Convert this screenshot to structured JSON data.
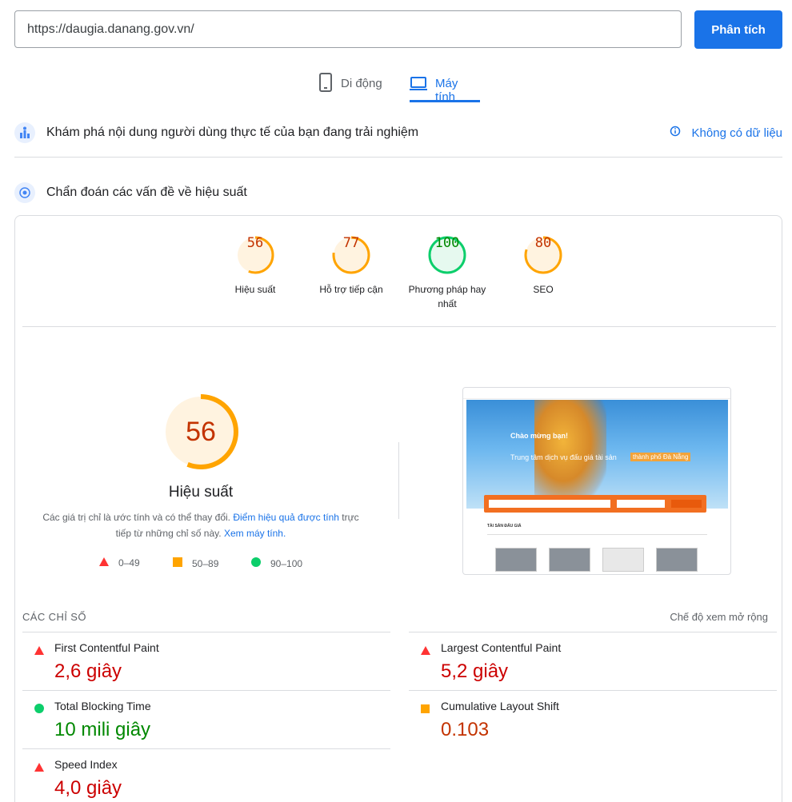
{
  "search": {
    "url": "https://daugia.danang.gov.vn/",
    "button": "Phân tích"
  },
  "tabs": {
    "mobile": "Di động",
    "desktop": "Máy tính"
  },
  "field_data": {
    "title": "Khám phá nội dung người dùng thực tế của bạn đang trải nghiệm",
    "no_data": "Không có dữ liệu"
  },
  "diagnose": {
    "title": "Chẩn đoán các vấn đề về hiệu suất"
  },
  "scores": [
    {
      "label": "Hiệu suất",
      "value": "56",
      "score": 56
    },
    {
      "label": "Hỗ trợ tiếp cận",
      "value": "77",
      "score": 77
    },
    {
      "label": "Phương pháp hay nhất",
      "value": "100",
      "score": 100
    },
    {
      "label": "SEO",
      "value": "80",
      "score": 80
    }
  ],
  "performance": {
    "score": "56",
    "title": "Hiệu suất",
    "desc_part1": "Các giá trị chỉ là ước tính và có thể thay đổi. ",
    "desc_link1": "Điểm hiệu quả được tính",
    "desc_part2": " trực tiếp từ những chỉ số này. ",
    "desc_link2": "Xem máy tính."
  },
  "legend": {
    "poor": "0–49",
    "average": "50–89",
    "good": "90–100"
  },
  "screenshot": {
    "hero_title": "Chào mừng bạn!",
    "hero_sub": "Trung tâm dịch vụ đấu giá tài sản",
    "hero_tag": "thành phố Đà Nẵng",
    "section": "TÀI SẢN ĐẤU GIÁ"
  },
  "metrics": {
    "title": "CÁC CHỈ SỐ",
    "expand": "Chế độ xem mở rộng",
    "items": [
      {
        "name": "First Contentful Paint",
        "value": "2,6 giây"
      },
      {
        "name": "Largest Contentful Paint",
        "value": "5,2 giây"
      },
      {
        "name": "Total Blocking Time",
        "value": "10 mili giây"
      },
      {
        "name": "Cumulative Layout Shift",
        "value": "0.103"
      },
      {
        "name": "Speed Index",
        "value": "4,0 giây"
      }
    ]
  },
  "colors": {
    "accent": "#1a73e8",
    "fail": "#ff3333",
    "average": "#ffa400",
    "pass": "#0cce6b"
  }
}
